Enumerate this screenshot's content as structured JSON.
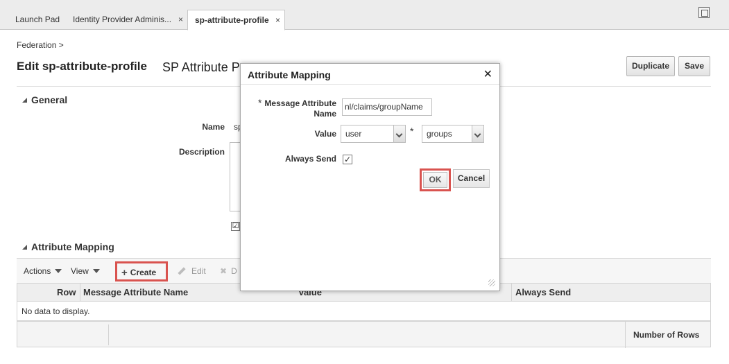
{
  "tabs": [
    {
      "label": "Launch Pad"
    },
    {
      "label": "Identity Provider Adminis...",
      "close": "×"
    },
    {
      "label": "sp-attribute-profile",
      "close": "×"
    }
  ],
  "breadcrumb": "Federation >",
  "page": {
    "title": "Edit sp-attribute-profile",
    "subtitle": "SP Attribute P",
    "duplicate_label": "Duplicate",
    "save_label": "Save"
  },
  "general": {
    "heading": "General",
    "name_label": "Name",
    "name_value": "sp",
    "description_label": "Description",
    "checkbox": "☑"
  },
  "attribute_mapping": {
    "heading": "Attribute Mapping",
    "toolbar": {
      "actions": "Actions",
      "view": "View",
      "create": "Create",
      "edit": "Edit",
      "delete": "D"
    },
    "columns": [
      "Row",
      "Message Attribute Name",
      "Value",
      "Always Send"
    ],
    "empty_text": "No data to display.",
    "footer_label": "Number of Rows"
  },
  "modal": {
    "title": "Attribute Mapping",
    "close": "✕",
    "message_attr_label": "Message Attribute Name",
    "required_mark": "*",
    "message_attr_value": "nl/claims/groupName",
    "value_label": "Value",
    "value_source": "user",
    "value_attr": "groups",
    "always_send_label": "Always Send",
    "always_send_checked": "✓",
    "ok_label": "OK",
    "cancel_label": "Cancel"
  },
  "colors": {
    "highlight": "#d9534f",
    "tab_bar": "#ececec"
  }
}
